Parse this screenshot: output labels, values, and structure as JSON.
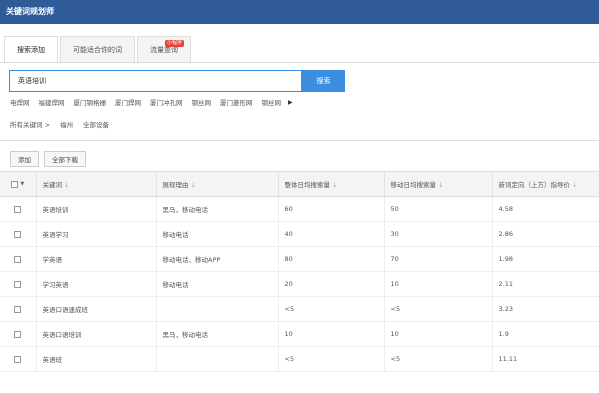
{
  "title": "关键词规划师",
  "tabs": [
    {
      "label": "搜索添加"
    },
    {
      "label": "可能适合你的词"
    },
    {
      "label": "流量查询",
      "badge": "小程序"
    }
  ],
  "search": {
    "value": "英语培训",
    "button": "搜索"
  },
  "hints": [
    "电焊网",
    "福建焊网",
    "厦门钢格栅",
    "厦门焊网",
    "厦门冲孔网",
    "钢丝网",
    "厦门菱形网",
    "钢丝网"
  ],
  "hint_more_icon": "triangle-right-icon",
  "filters": {
    "scope": "所有关键词 >",
    "region": "福州",
    "device": "全部设备"
  },
  "toolbar": {
    "add": "添加",
    "download": "全部下载"
  },
  "columns": [
    "关键词",
    "展现理由",
    "整体日均搜索量",
    "移动日均搜索量",
    "新词定向（上方）指导价"
  ],
  "sort_icon": "↓",
  "rows": [
    [
      "英语培训",
      "黑马，移动电话",
      "60",
      "50",
      "4.58"
    ],
    [
      "英语学习",
      "移动电话",
      "40",
      "30",
      "2.86"
    ],
    [
      "学英语",
      "移动电话，移动APP",
      "80",
      "70",
      "1.98"
    ],
    [
      "学习英语",
      "移动电话",
      "20",
      "10",
      "2.11"
    ],
    [
      "英语口语速成班",
      "",
      "<5",
      "<5",
      "3.23"
    ],
    [
      "英语口语培训",
      "黑马，移动电话",
      "10",
      "10",
      "1.9"
    ],
    [
      "英语班",
      "",
      "<5",
      "<5",
      "11.11"
    ]
  ]
}
